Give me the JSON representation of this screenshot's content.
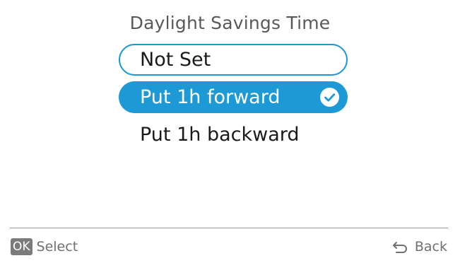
{
  "title": "Daylight Savings Time",
  "options": [
    {
      "label": "Not Set",
      "focused": true,
      "selected": false
    },
    {
      "label": "Put 1h forward",
      "focused": false,
      "selected": true
    },
    {
      "label": "Put 1h backward",
      "focused": false,
      "selected": false
    }
  ],
  "footer": {
    "ok_key": "OK",
    "ok_label": "Select",
    "back_label": "Back",
    "back_icon": "back-arrow-icon"
  },
  "colors": {
    "accent": "#1d9ad6",
    "title_text": "#595959",
    "hint_text": "#707070"
  }
}
